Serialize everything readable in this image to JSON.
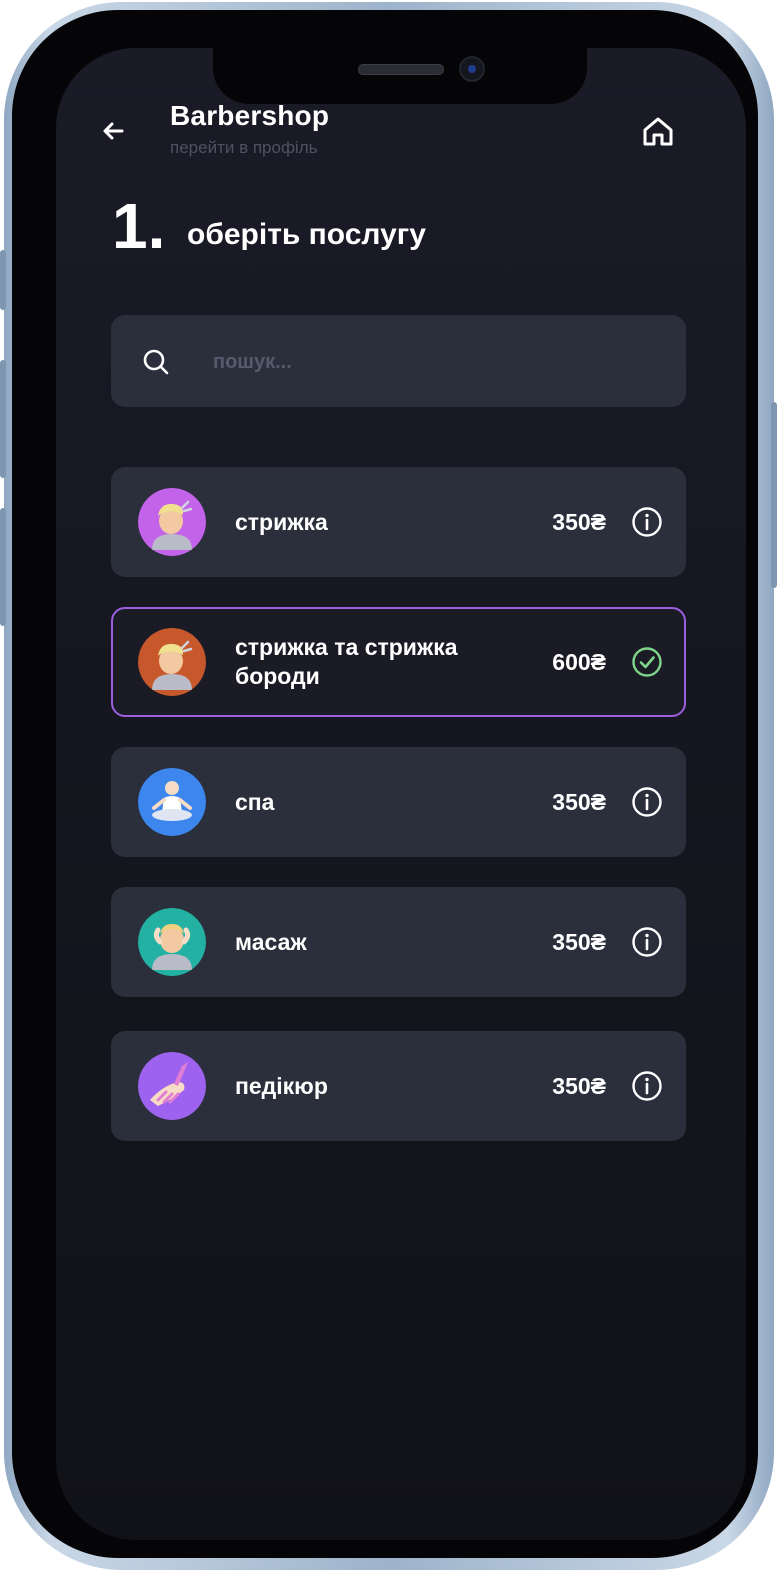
{
  "header": {
    "title": "Barbershop",
    "subtitle": "перейти в профіль",
    "back_icon": "arrow-left-icon",
    "home_icon": "home-icon"
  },
  "step": {
    "number": "1.",
    "title": "оберіть послугу"
  },
  "search": {
    "placeholder": "пошук...",
    "value": "",
    "icon": "search-icon"
  },
  "services": [
    {
      "name": "стрижка",
      "price": "350₴",
      "action_icon": "info-icon",
      "selected": false,
      "avatar_color": "#c363ea",
      "avatar_icon": "haircut-person-icon"
    },
    {
      "name": "стрижка та стрижка бороди",
      "price": "600₴",
      "action_icon": "check-circle-icon",
      "selected": true,
      "avatar_color": "#c6582c",
      "avatar_icon": "haircut-beard-person-icon"
    },
    {
      "name": "спа",
      "price": "350₴",
      "action_icon": "info-icon",
      "selected": false,
      "avatar_color": "#3d86ee",
      "avatar_icon": "meditating-person-icon"
    },
    {
      "name": "масаж",
      "price": "350₴",
      "action_icon": "info-icon",
      "selected": false,
      "avatar_color": "#22b1a3",
      "avatar_icon": "face-massage-icon"
    },
    {
      "name": "педікюр",
      "price": "350₴",
      "action_icon": "info-icon",
      "selected": false,
      "avatar_color": "#9d63f0",
      "avatar_icon": "nail-polish-icon"
    }
  ],
  "colors": {
    "background": "#161620",
    "card": "#2b2e3b",
    "selected_border": "#9c5fe0",
    "check_green": "#7fd68b",
    "subtitle": "#4f5162"
  }
}
